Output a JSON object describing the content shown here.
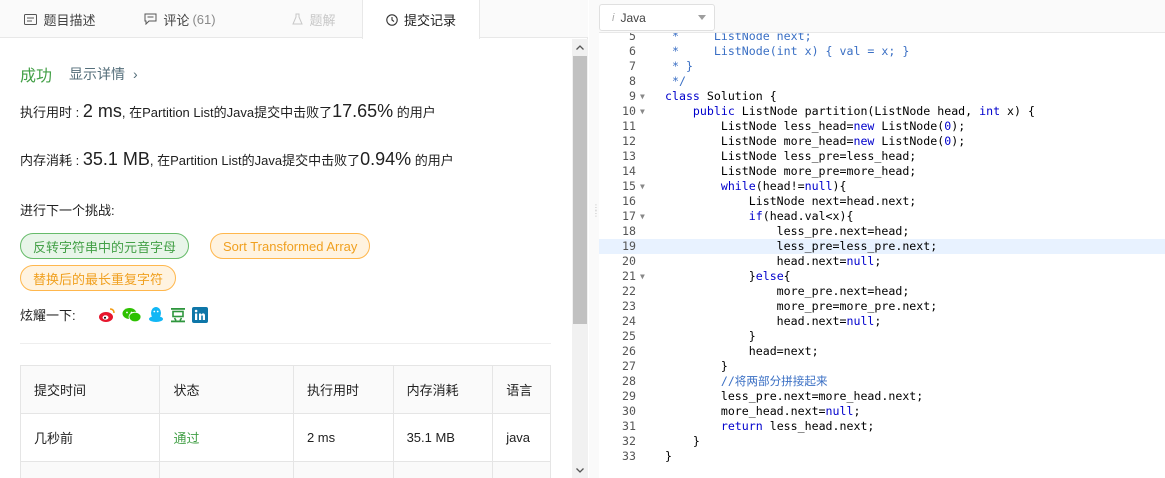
{
  "tabs": [
    {
      "label": "题目描述",
      "icon": "description-icon"
    },
    {
      "label": "评论",
      "count": "(61)",
      "icon": "comment-icon"
    },
    {
      "label": "题解",
      "icon": "flask-icon"
    },
    {
      "label": "提交记录",
      "icon": "clock-icon"
    }
  ],
  "result": {
    "status": "成功",
    "detail_link": "显示详情",
    "runtime": {
      "label": "执行用时 :",
      "value": "2 ms",
      "mid": ", 在Partition List的Java提交中击败了",
      "percent": "17.65%",
      "suffix": "的用户"
    },
    "memory": {
      "label": "内存消耗 :",
      "value": "35.1 MB",
      "mid": ", 在Partition List的Java提交中击败了",
      "percent": "0.94%",
      "suffix": "的用户"
    }
  },
  "next_challenge": {
    "label": "进行下一个挑战:",
    "items": [
      "反转字符串中的元音字母",
      "Sort Transformed Array",
      "替换后的最长重复字符"
    ]
  },
  "share": {
    "label": "炫耀一下:",
    "icons": [
      "weibo-icon",
      "wechat-icon",
      "qq-icon",
      "douban-icon",
      "linkedin-icon"
    ]
  },
  "table": {
    "headers": [
      "提交时间",
      "状态",
      "执行用时",
      "内存消耗",
      "语言"
    ],
    "rows": [
      [
        "几秒前",
        "通过",
        "2 ms",
        "35.1 MB",
        "java"
      ]
    ]
  },
  "editor": {
    "language": "Java",
    "highlight_line": 19,
    "lines": [
      {
        "n": "5",
        "fold": false,
        "html": "<span class='cm'> *     ListNode next;</span>"
      },
      {
        "n": "6",
        "fold": false,
        "html": "<span class='cm'> *     ListNode(int x) { val = x; }</span>"
      },
      {
        "n": "7",
        "fold": false,
        "html": "<span class='cm'> * }</span>"
      },
      {
        "n": "8",
        "fold": false,
        "html": "<span class='cm'> */</span>"
      },
      {
        "n": "9",
        "fold": true,
        "html": "<span class='kw'>class</span> Solution {"
      },
      {
        "n": "10",
        "fold": true,
        "html": "    <span class='kw'>public</span> ListNode partition(ListNode head, <span class='kw'>int</span> x) {"
      },
      {
        "n": "11",
        "fold": false,
        "html": "        ListNode less_head=<span class='kw'>new</span> ListNode(<span class='num'>0</span>);"
      },
      {
        "n": "12",
        "fold": false,
        "html": "        ListNode more_head=<span class='kw'>new</span> ListNode(<span class='num'>0</span>);"
      },
      {
        "n": "13",
        "fold": false,
        "html": "        ListNode less_pre=less_head;"
      },
      {
        "n": "14",
        "fold": false,
        "html": "        ListNode more_pre=more_head;"
      },
      {
        "n": "15",
        "fold": true,
        "html": "        <span class='kw'>while</span>(head!=<span class='lit'>null</span>){"
      },
      {
        "n": "16",
        "fold": false,
        "html": "            ListNode next=head.next;"
      },
      {
        "n": "17",
        "fold": true,
        "html": "            <span class='kw'>if</span>(head.val&lt;x){"
      },
      {
        "n": "18",
        "fold": false,
        "html": "                less_pre.next=head;"
      },
      {
        "n": "19",
        "fold": false,
        "html": "                less_pre=less_pre.next;"
      },
      {
        "n": "20",
        "fold": false,
        "html": "                head.next=<span class='lit'>null</span>;"
      },
      {
        "n": "21",
        "fold": true,
        "html": "            }<span class='kw'>else</span>{"
      },
      {
        "n": "22",
        "fold": false,
        "html": "                more_pre.next=head;"
      },
      {
        "n": "23",
        "fold": false,
        "html": "                more_pre=more_pre.next;"
      },
      {
        "n": "24",
        "fold": false,
        "html": "                head.next=<span class='lit'>null</span>;"
      },
      {
        "n": "25",
        "fold": false,
        "html": "            }"
      },
      {
        "n": "26",
        "fold": false,
        "html": "            head=next;"
      },
      {
        "n": "27",
        "fold": false,
        "html": "        }"
      },
      {
        "n": "28",
        "fold": false,
        "html": "        <span class='cm'>//将两部分拼接起来</span>"
      },
      {
        "n": "29",
        "fold": false,
        "html": "        less_pre.next=more_head.next;"
      },
      {
        "n": "30",
        "fold": false,
        "html": "        more_head.next=<span class='lit'>null</span>;"
      },
      {
        "n": "31",
        "fold": false,
        "html": "        <span class='kw'>return</span> less_head.next;"
      },
      {
        "n": "32",
        "fold": false,
        "html": "    }"
      },
      {
        "n": "33",
        "fold": false,
        "html": "}"
      }
    ]
  },
  "colors": {
    "success": "#43a047",
    "link": "#546e7a",
    "chip_green_bg": "#e8f5e9",
    "chip_orange_bg": "#fff3e0",
    "keyword": "#0000cc",
    "comment": "#3a6fc4",
    "highlight": "#e8f2ff"
  }
}
